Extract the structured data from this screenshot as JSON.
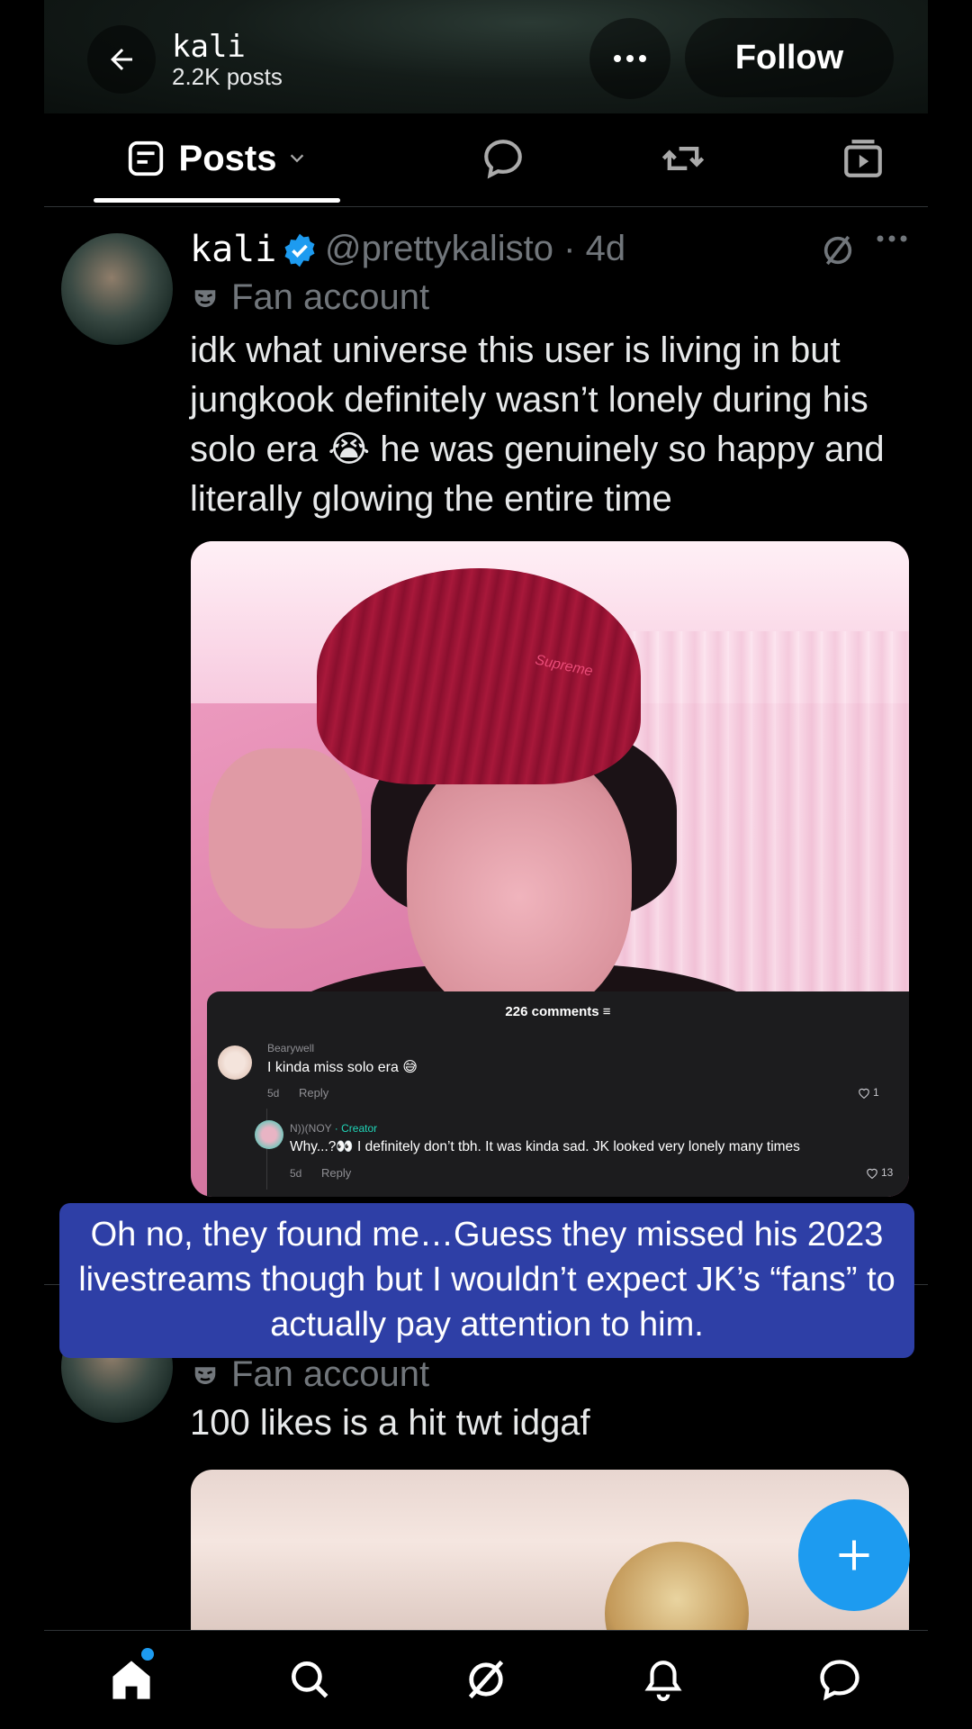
{
  "header": {
    "name": "kali",
    "post_count": "2.2K posts",
    "follow_label": "Follow"
  },
  "tabs": {
    "posts_label": "Posts"
  },
  "tweet1": {
    "display_name": "kali",
    "handle_time": "@prettykalisto · 4d",
    "badge_label": "Fan account",
    "text": "idk what universe this user is living in but jungkook definitely wasn’t lonely during his solo era 😭 he was genuinely so happy and literally glowing the entire time",
    "image_text": "Supreme",
    "comments": {
      "header": "226 comments",
      "first": {
        "user": "Bearywell",
        "text": "I kinda miss solo era 😅",
        "age": "5d",
        "reply": "Reply",
        "likes": "1"
      },
      "second": {
        "user": "N))(NOY",
        "creator_label": "· Creator",
        "text": "Why...?👀 I definitely don’t tbh. It was kinda sad. JK looked very lonely many times",
        "age": "5d",
        "reply": "Reply",
        "likes": "13"
      }
    }
  },
  "overlay_caption": "Oh no, they found me…Guess they missed his 2023 livestreams though but I wouldn’t expect JK’s “fans” to actually pay attention to him.",
  "tweet2": {
    "badge_label": "Fan account",
    "text": "100 likes is a hit twt idgaf"
  },
  "icons": [
    "back-arrow-icon",
    "more-icon",
    "posts-tab-icon",
    "chevron-down-icon",
    "replies-icon",
    "reposts-icon",
    "media-icon",
    "verified-icon",
    "grok-icon",
    "fan-mask-icon",
    "compose-plus-icon",
    "home-icon",
    "search-icon",
    "grok-nav-icon",
    "bell-icon",
    "messages-icon"
  ],
  "colors": {
    "accent": "#1d9bf0",
    "overlay": "#2e3fa6",
    "background": "#000000"
  }
}
